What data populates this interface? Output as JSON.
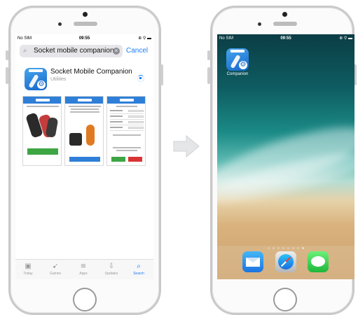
{
  "left_phone": {
    "status": {
      "carrier": "No SIM",
      "time": "09:55",
      "indicators": "⊕ ⚲ ▬"
    },
    "search": {
      "query": "Socket mobile companion",
      "cancel_label": "Cancel"
    },
    "result": {
      "app_name": "Socket Mobile Companion",
      "category": "Utilities"
    },
    "tabs": [
      {
        "label": "Today",
        "icon": "today-icon"
      },
      {
        "label": "Games",
        "icon": "rocket-icon"
      },
      {
        "label": "Apps",
        "icon": "stack-icon"
      },
      {
        "label": "Updates",
        "icon": "download-icon"
      },
      {
        "label": "Search",
        "icon": "search-icon"
      }
    ],
    "active_tab": "Search"
  },
  "right_phone": {
    "status": {
      "carrier": "No SIM",
      "time": "09:55",
      "indicators": "⊕ ⚲ ▬"
    },
    "home_app_label": "Companion",
    "dock": [
      {
        "name": "Mail",
        "icon": "mail-icon"
      },
      {
        "name": "Safari",
        "icon": "safari-icon"
      },
      {
        "name": "Messages",
        "icon": "messages-icon"
      }
    ],
    "page_dots": 8,
    "active_dot": 8
  },
  "colors": {
    "accent": "#1a7cf5",
    "brand_blue": "#2f7fd8",
    "green": "#3da542"
  }
}
